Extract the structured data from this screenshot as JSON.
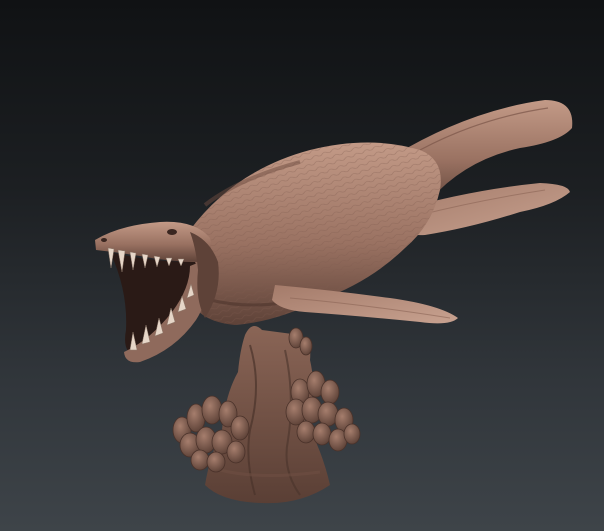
{
  "scene": {
    "subject_icon": "sea-reptile-sculpture",
    "colors": {
      "background_top": "#101214",
      "background_bottom": "#3e4449",
      "clay_light": "#b48a78",
      "clay_mid": "#8f6a5c",
      "clay_dark": "#5e4238",
      "mouth_dark": "#2a1a16",
      "teeth": "#e6d6c8"
    }
  }
}
